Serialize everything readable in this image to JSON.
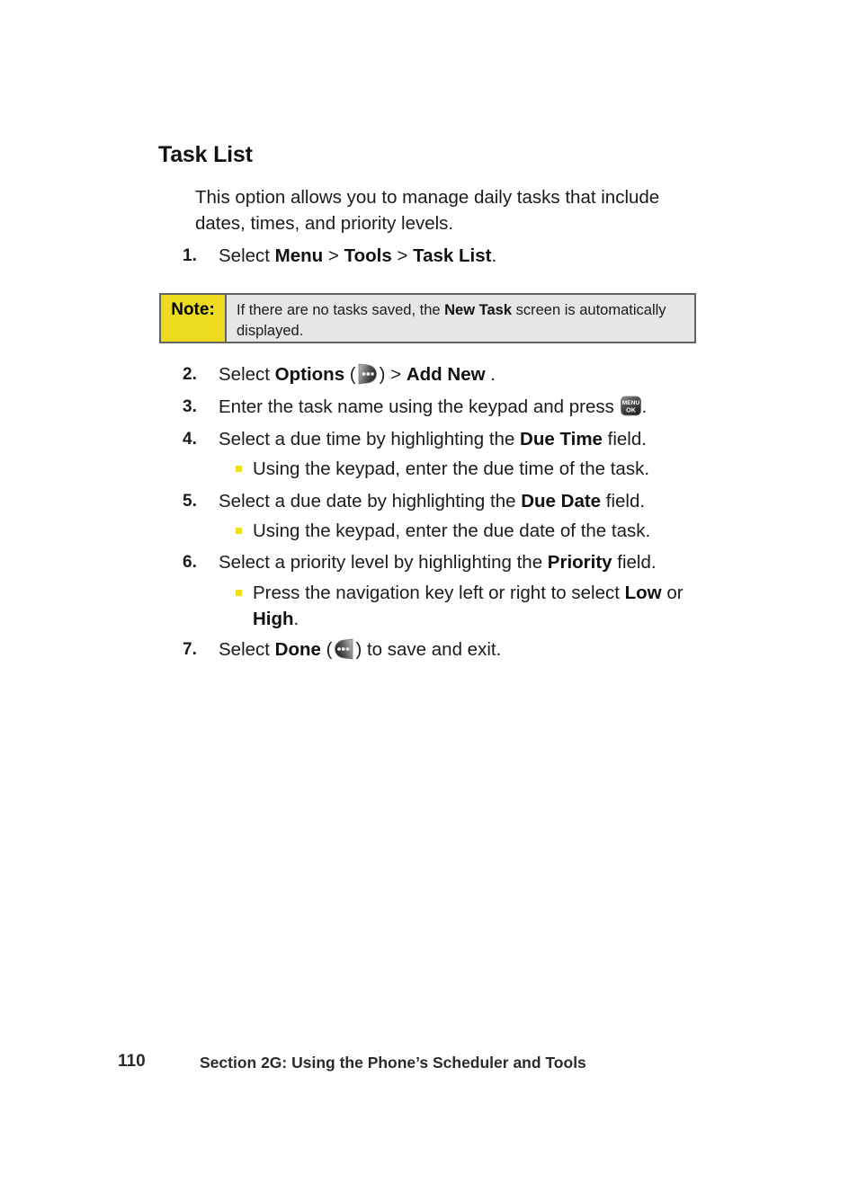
{
  "document": {
    "heading": "Task List",
    "intro": "This option allows you to manage daily tasks that include dates, times, and priority levels."
  },
  "note": {
    "label": "Note:",
    "text_part1": "If there are no tasks saved, the ",
    "text_bold": "New Task",
    "text_part2": " screen is automatically displayed."
  },
  "steps": [
    {
      "number": "1.",
      "segments": [
        {
          "text": "Select ",
          "bold": false
        },
        {
          "text": "Menu",
          "bold": true
        },
        {
          "text": " > ",
          "bold": false
        },
        {
          "text": "Tools",
          "bold": true
        },
        {
          "text": " > ",
          "bold": false
        },
        {
          "text": "Task List",
          "bold": true
        },
        {
          "text": ".",
          "bold": false
        }
      ]
    },
    {
      "number": "2.",
      "segments": [
        {
          "text": "Select ",
          "bold": false
        },
        {
          "text": "Options",
          "bold": true
        },
        {
          "text": " (",
          "bold": false
        },
        {
          "icon": "options-softkey-icon"
        },
        {
          "text": ") > ",
          "bold": false
        },
        {
          "text": "Add New",
          "bold": true
        },
        {
          "text": " .",
          "bold": false
        }
      ]
    },
    {
      "number": "3.",
      "segments": [
        {
          "text": "Enter the task name using the keypad and press ",
          "bold": false
        },
        {
          "icon": "menu-ok-key-icon"
        },
        {
          "text": ".",
          "bold": false
        }
      ]
    },
    {
      "number": "4.",
      "segments": [
        {
          "text": "Select a due time by highlighting the ",
          "bold": false
        },
        {
          "text": "Due Time",
          "bold": true
        },
        {
          "text": " field.",
          "bold": false
        }
      ]
    },
    {
      "number": "5.",
      "segments": [
        {
          "text": "Select a due date by highlighting the ",
          "bold": false
        },
        {
          "text": "Due Date",
          "bold": true
        },
        {
          "text": " field.",
          "bold": false
        }
      ]
    },
    {
      "number": "6.",
      "segments": [
        {
          "text": "Select a priority level by highlighting the ",
          "bold": false
        },
        {
          "text": "Priority",
          "bold": true
        },
        {
          "text": " field.",
          "bold": false
        }
      ]
    },
    {
      "number": "7.",
      "segments": [
        {
          "text": "Select ",
          "bold": false
        },
        {
          "text": "Done",
          "bold": true
        },
        {
          "text": " (",
          "bold": false
        },
        {
          "icon": "done-softkey-icon"
        },
        {
          "text": ") to save and exit.",
          "bold": false
        }
      ]
    }
  ],
  "sub_bullets": {
    "after_step_4": "Using the keypad, enter the due time of the task.",
    "after_step_5": "Using the keypad, enter the due date of the task.",
    "after_step_6_part1": "Press the navigation key left or right to select ",
    "after_step_6_bold1": "Low",
    "after_step_6_part2": " or ",
    "after_step_6_bold2": "High",
    "after_step_6_part3": "."
  },
  "icons": {
    "options_softkey": "options-softkey-icon",
    "menu_ok_key": "menu-ok-key-icon",
    "done_softkey": "done-softkey-icon",
    "menu_ok_label_top": "MENU",
    "menu_ok_label_bottom": "OK"
  },
  "footer": {
    "page_number": "110",
    "section_text": "Section 2G: Using the Phone’s Scheduler and Tools"
  },
  "colors": {
    "note_label_yellow": "#ecdb1f",
    "note_body_gray": "#e6e6e6",
    "note_border": "#636363",
    "bullet_yellow": "#ece01f",
    "text": "#1b1b1b"
  }
}
